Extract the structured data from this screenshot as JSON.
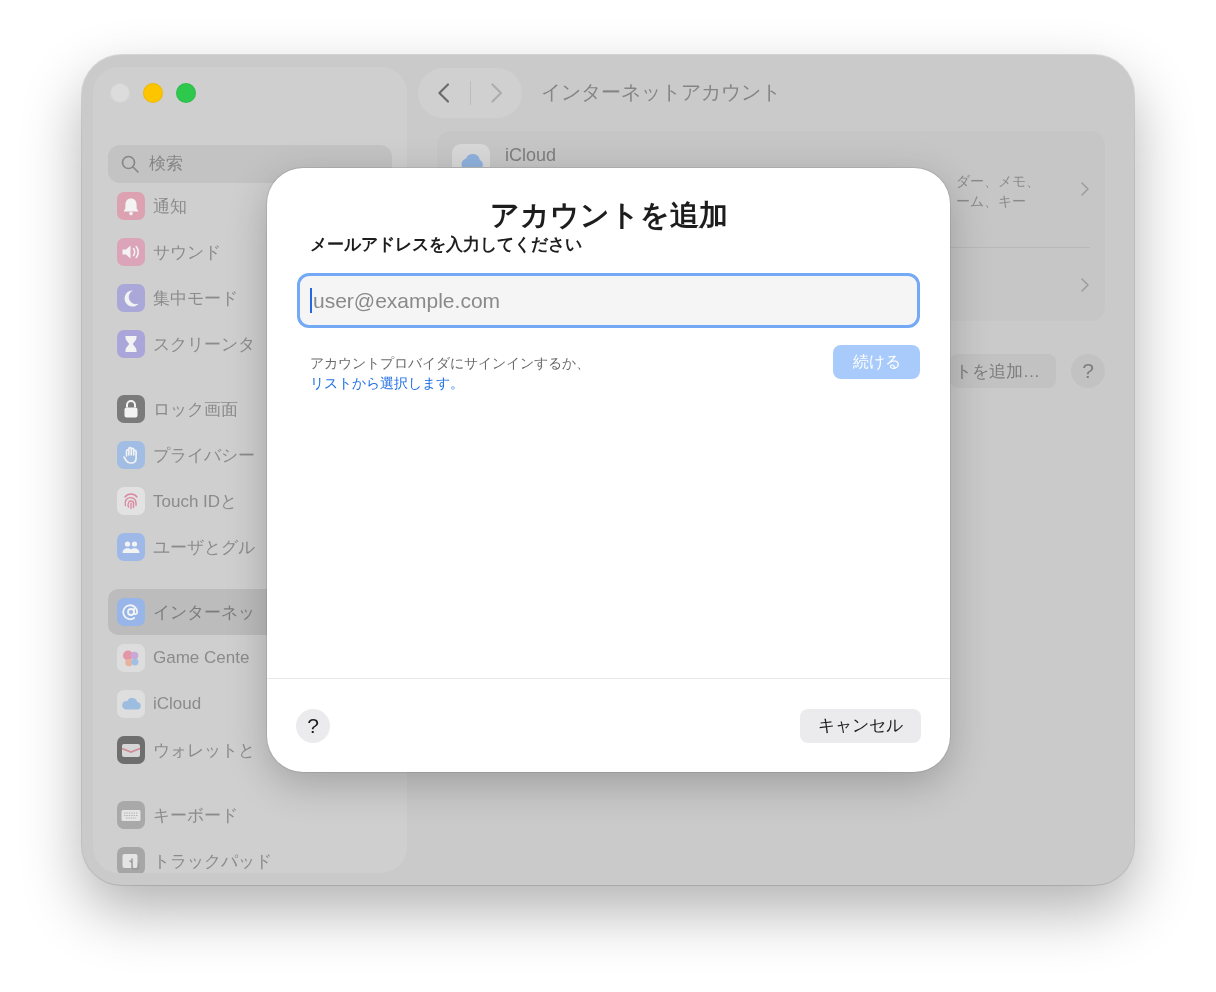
{
  "window": {
    "traffic_lights": [
      {
        "kind": "close",
        "disabled": true
      },
      {
        "kind": "minimize",
        "disabled": false
      },
      {
        "kind": "zoom",
        "disabled": false
      }
    ]
  },
  "sidebar": {
    "search": {
      "placeholder": "検索"
    },
    "sections": [
      {
        "items": [
          {
            "label": "通知",
            "color": "#dca2b1",
            "selected": false
          },
          {
            "label": "サウンド",
            "color": "#dba4b8",
            "selected": false
          },
          {
            "label": "集中モード",
            "color": "#a9a8d9",
            "selected": false
          },
          {
            "label": "スクリーンタ",
            "color": "#aaa6da",
            "selected": false
          }
        ]
      },
      {
        "items": [
          {
            "label": "ロック画面",
            "color": "#7b7b7b",
            "selected": false
          },
          {
            "label": "プライバシー",
            "color": "#a2bde3",
            "selected": false
          },
          {
            "label": "Touch IDと",
            "color": "#e2e2e2",
            "selected": false
          },
          {
            "label": "ユーザとグル",
            "color": "#9eb9e8",
            "selected": false
          }
        ]
      },
      {
        "items": [
          {
            "label": "インターネッ",
            "color": "#97b5e8",
            "selected": true
          },
          {
            "label": "Game Cente",
            "color": "#dddddd",
            "selected": false
          },
          {
            "label": "iCloud",
            "color": "#dedede",
            "selected": false
          },
          {
            "label": "ウォレットと",
            "color": "#6e6e6e",
            "selected": false
          }
        ]
      },
      {
        "items": [
          {
            "label": "キーボード",
            "color": "#a9a9a9",
            "selected": false
          },
          {
            "label": "トラックパッド",
            "color": "#a6a6a6",
            "selected": false
          }
        ]
      }
    ]
  },
  "toolbar": {
    "nav": [
      {
        "kind": "back",
        "disabled": false
      },
      {
        "kind": "forward",
        "disabled": true
      }
    ],
    "title": "インターネットアカウント"
  },
  "accounts": [
    {
      "name": "iCloud",
      "details": [
        "ダー、メモ、",
        "ーム、キー"
      ]
    }
  ],
  "actions": {
    "add_button": "トを追加…",
    "help_button": "?"
  },
  "dialog": {
    "title": "アカウントを追加",
    "prompt": "メールアドレスを入力してください",
    "email_field": {
      "placeholder": "user@example.com",
      "focused": true
    },
    "hint": {
      "text": "アカウントプロバイダにサインインするか、",
      "link": "リストから選択します。"
    },
    "continue_button": {
      "label": "続ける",
      "disabled": true
    },
    "help_button": "?",
    "cancel_button": "キャンセル"
  }
}
